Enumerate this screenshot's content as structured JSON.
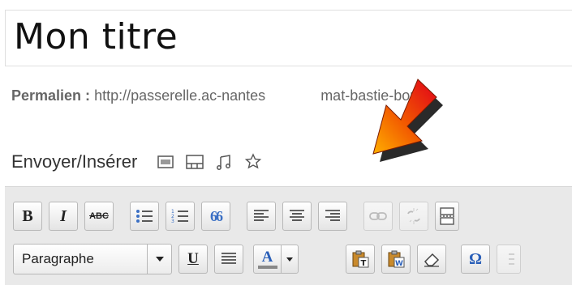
{
  "post": {
    "title": "Mon titre",
    "permalink_label": "Permalien :",
    "permalink_url": "http://passerelle.ac-nantes",
    "permalink_url_tail": "mat-bastie-bou"
  },
  "media": {
    "label": "Envoyer/Insérer",
    "icons": [
      "image-icon",
      "video-icon",
      "audio-icon",
      "media-icon"
    ]
  },
  "toolbar": {
    "bold": "B",
    "italic": "I",
    "strike": "ABC",
    "quote": "66",
    "underline": "U",
    "text_color": "A",
    "special_char": "Ω",
    "format_select": "Paragraphe"
  },
  "colors": {
    "arrow_red": "#e0001a",
    "arrow_yellow": "#ffb000",
    "link_blue": "#21759b"
  }
}
